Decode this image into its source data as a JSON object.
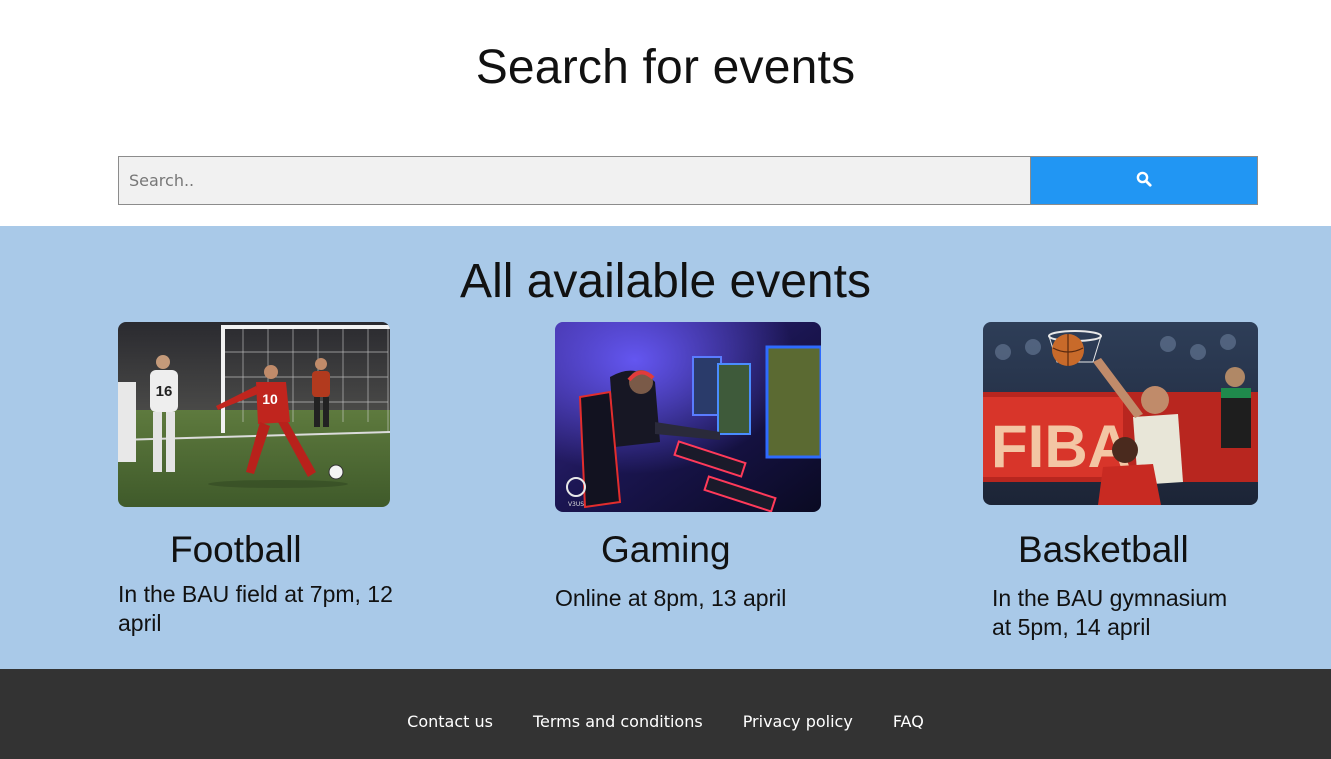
{
  "header": {
    "title": "Search for events"
  },
  "search": {
    "placeholder": "Search..",
    "value": "",
    "button_icon": "search-icon",
    "button_color": "#2196f3"
  },
  "events": {
    "title": "All available events",
    "background": "#a9c9e8",
    "items": [
      {
        "title": "Football",
        "description": "In the BAU field at 7pm, 12 april",
        "image": "football-photo"
      },
      {
        "title": "Gaming",
        "description": "Online at 8pm, 13 april",
        "image": "gaming-photo"
      },
      {
        "title": "Basketball",
        "description": "In the BAU gymnasium at 5pm, 14 april",
        "image": "basketball-photo"
      }
    ],
    "photo_texts": {
      "football_jersey_1": "16",
      "football_jersey_2": "10",
      "basketball_banner": "FIBA",
      "gaming_logo": "V3US"
    }
  },
  "footer": {
    "background": "#333333",
    "links": [
      "Contact us",
      "Terms and conditions",
      "Privacy policy",
      "FAQ"
    ]
  }
}
